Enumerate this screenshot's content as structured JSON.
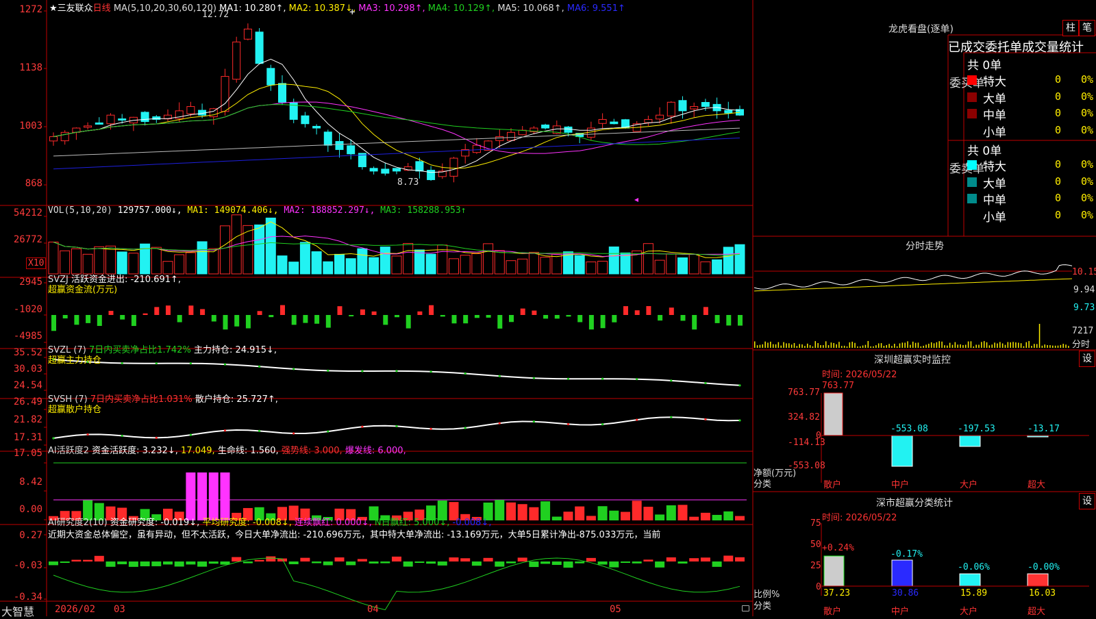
{
  "colors": {
    "up": "#ff2a2a",
    "down": "#22f2f2",
    "grid": "#c00000",
    "white": "#ffffff",
    "yellow": "#ffee00",
    "magenta": "#ff33ff",
    "green": "#20d020",
    "blue": "#1e20e0"
  },
  "main": {
    "stock": "★三友联众",
    "period": "日线",
    "ma_params": "MA(5,10,20,30,60,120)",
    "ma1": "MA1: 10.280↑,",
    "ma2": "MA2: 10.387↓,",
    "ma3": "MA3: 10.298↑,",
    "ma4": "MA4: 10.129↑,",
    "ma5": "MA5: 10.068↑,",
    "ma6": "MA6: 9.551↑",
    "y_ticks": [
      "1272",
      "1138",
      "1003",
      "868"
    ],
    "high_label": "12.72",
    "low_label": "8.73",
    "crosshair": "+"
  },
  "vol": {
    "params": "VOL(5,10,20)",
    "value": "129757.000↓,",
    "ma1": "MA1: 149074.406↓,",
    "ma2": "MA2: 188852.297↓,",
    "ma3": "MA3: 158288.953↑",
    "y_ticks": [
      "54212",
      "26772"
    ],
    "unit": "X10"
  },
  "svzj": {
    "name": "SVZJ",
    "label": "活跃资金进出:",
    "value": "-210.691↑,",
    "title": "超赢资金流(万元)",
    "y_ticks": [
      "2945",
      "-1020",
      "-4985"
    ]
  },
  "svzl": {
    "head": "SVZL (7)",
    "net": "7日内买卖净占比1.742%",
    "hold": "主力持仓: 24.915↓,",
    "title": "超赢主力持仓",
    "y_ticks": [
      "35.52",
      "30.03",
      "24.54"
    ]
  },
  "svsh": {
    "head": "SVSH (7)",
    "net": "7日内买卖净占比1.031%",
    "hold": "散户持仓: 25.727↑,",
    "title": "超赢散户持仓",
    "y_ticks": [
      "26.49",
      "21.82",
      "17.31"
    ]
  },
  "ai1": {
    "head": "AI活跃度2",
    "a": "资金活跃度: 3.232↓,",
    "b": "17.049,",
    "c": "生命线: 1.560,",
    "d": "强势线: 3.000,",
    "e": "爆发线: 6.000,",
    "y_ticks": [
      "17.05",
      "8.42",
      "0.00"
    ]
  },
  "ai2": {
    "head": "AI研究度2(10)",
    "a": "资金研究度: -0.019↓,",
    "b": "平均研究度: -0.008↓,",
    "c": "连续飘红: 0.000↓,",
    "d": "N日飘红: 5.000↓,",
    "e": "-0.008↓,",
    "summary": "近期大资金总体偏空，虽有异动，但不太活跃，今日大单净流出: -210.696万元，其中特大单净流出: -13.169万元，大单5日累计净出-875.033万元，当前",
    "y_ticks": [
      "0.27",
      "-0.03",
      "-0.34"
    ]
  },
  "xaxis": {
    "brand": "大智慧",
    "labels": [
      "2026/02",
      "03",
      "04",
      "05"
    ]
  },
  "chart_data": [
    {
      "type": "candlestick",
      "title": "",
      "y_ticks": [
        "1272",
        "1138",
        "1003",
        "868"
      ],
      "series": [
        {
          "name": "MA1"
        },
        {
          "name": "MA2"
        },
        {
          "name": "MA3"
        },
        {
          "name": "MA4"
        },
        {
          "name": "MA5"
        },
        {
          "name": "MA6"
        }
      ],
      "annotations": [
        "12.72",
        "8.73"
      ]
    },
    {
      "type": "bar",
      "title": "",
      "series": [
        {
          "name": "VOL"
        },
        {
          "name": "MA1"
        },
        {
          "name": "MA2"
        },
        {
          "name": "MA3"
        }
      ]
    },
    {
      "type": "bar",
      "title": "超赢资金流(万元)",
      "ylim": [
        -4985,
        2945
      ]
    }
  ],
  "right": {
    "lhb_title": "龙虎看盘(逐单)",
    "btn_zhu": "柱",
    "btn_bi": "笔",
    "stats_title": "已成交委托单成交量统计",
    "buy_side": "委买单",
    "sell_side": "委卖单",
    "buy_total": "共 0单",
    "sell_total": "共 0单",
    "buy_rows": [
      {
        "name": "特大",
        "val": "0",
        "pct": "0%",
        "color": "#ff0000"
      },
      {
        "name": "大单",
        "val": "0",
        "pct": "0%",
        "color": "#8b0000"
      },
      {
        "name": "中单",
        "val": "0",
        "pct": "0%",
        "color": "#8b0000"
      },
      {
        "name": "小单",
        "val": "0",
        "pct": "0%",
        "color": ""
      }
    ],
    "sell_rows": [
      {
        "name": "特大",
        "val": "0",
        "pct": "0%",
        "color": "#00ffff"
      },
      {
        "name": "大单",
        "val": "0",
        "pct": "0%",
        "color": "#008b8b"
      },
      {
        "name": "中单",
        "val": "0",
        "pct": "0%",
        "color": "#008b8b"
      },
      {
        "name": "小单",
        "val": "0",
        "pct": "0%",
        "color": ""
      }
    ],
    "intraday_title": "分时走势",
    "intraday_ticks": [
      "10.15",
      "9.94",
      "9.73",
      "7217"
    ],
    "intraday_unit": "分时",
    "monitor_title": "深圳超赢实时监控",
    "monitor_btn": "设",
    "monitor_time": "时间: 2026/05/22",
    "monitor_y": [
      "763.77",
      "324.82",
      "0",
      "-114.13",
      "-553.08"
    ],
    "monitor_axis": "净额(万元)",
    "monitor_axis2": "分类",
    "monitor_cats": [
      "散户",
      "中户",
      "大户",
      "超大"
    ],
    "monitor_vals": [
      "763.77",
      "-553.08",
      "-197.53",
      "-13.17"
    ],
    "class_title": "深市超赢分类统计",
    "class_btn": "设",
    "class_time": "时间: 2026/05/22",
    "class_y": [
      "75",
      "50",
      "25",
      "0"
    ],
    "class_axis": "比例%",
    "class_axis2": "分类",
    "class_pct": [
      "+0.24%",
      "-0.17%",
      "-0.06%",
      "-0.00%"
    ],
    "class_vals": [
      "37.23",
      "30.86",
      "15.89",
      "16.03"
    ],
    "class_cats": [
      "散户",
      "中户",
      "大户",
      "超大"
    ]
  }
}
